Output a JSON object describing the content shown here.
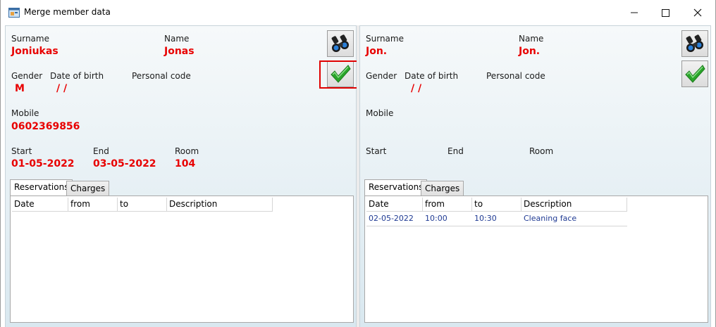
{
  "window": {
    "title": "Merge member data",
    "controls": {
      "minimize": "—",
      "maximize": "☐",
      "close": "✕"
    }
  },
  "left": {
    "labels": {
      "surname": "Surname",
      "name": "Name",
      "gender": "Gender",
      "dob": "Date of birth",
      "personal_code": "Personal code",
      "mobile": "Mobile",
      "start": "Start",
      "end": "End",
      "room": "Room"
    },
    "values": {
      "surname": "Joniukas",
      "name": "Jonas",
      "gender": "M",
      "dob": "/  /",
      "personal_code": "",
      "mobile": "0602369856",
      "start": "01-05-2022",
      "end": "03-05-2022",
      "room": "104"
    },
    "tabs": [
      "Reservations",
      "Charges"
    ],
    "columns": [
      "Date",
      "from",
      "to",
      "Description"
    ],
    "rows": []
  },
  "right": {
    "labels": {
      "surname": "Surname",
      "name": "Name",
      "gender": "Gender",
      "dob": "Date of birth",
      "personal_code": "Personal code",
      "mobile": "Mobile",
      "start": "Start",
      "end": "End",
      "room": "Room"
    },
    "values": {
      "surname": "Jon.",
      "name": "Jon.",
      "gender": "",
      "dob": "/  /",
      "personal_code": "",
      "mobile": "",
      "start": "",
      "end": "",
      "room": ""
    },
    "tabs": [
      "Reservations",
      "Charges"
    ],
    "columns": [
      "Date",
      "from",
      "to",
      "Description"
    ],
    "rows": [
      {
        "date": "02-05-2022",
        "from": "10:00",
        "to": "10:30",
        "description": "Cleaning face"
      }
    ]
  },
  "icons": {
    "search": "binoculars-icon",
    "confirm": "checkmark-icon"
  },
  "colors": {
    "value_text": "#e80000",
    "row_text": "#1f3a93",
    "highlight": "#e00000",
    "check_green": "#2aa52a"
  }
}
